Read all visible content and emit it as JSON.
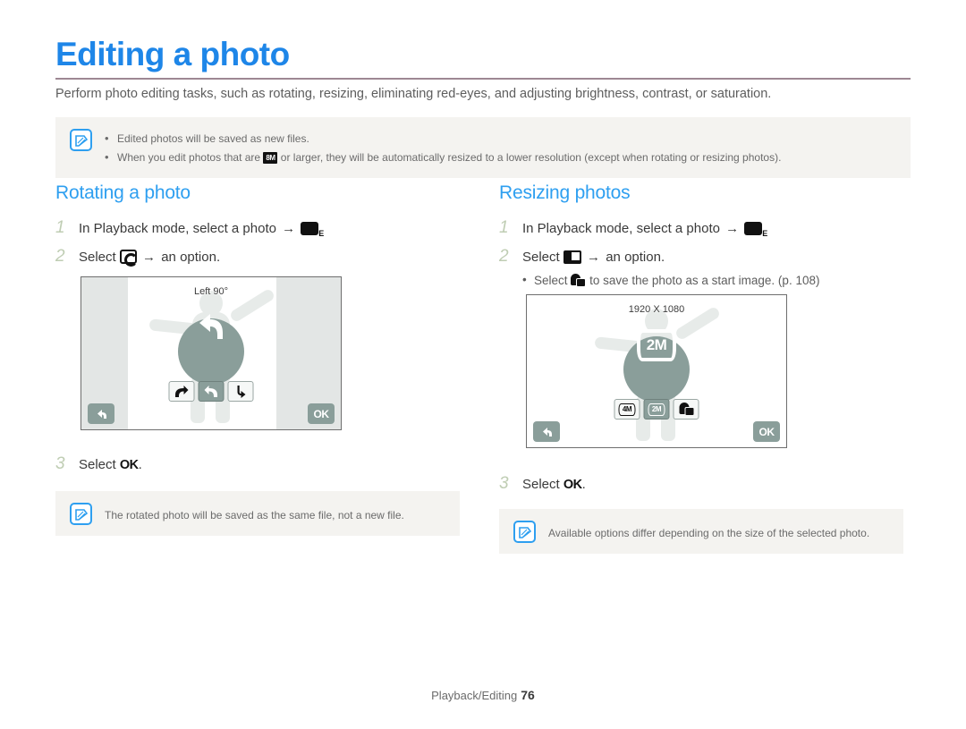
{
  "document": {
    "title": "Editing a photo",
    "intro": "Perform photo editing tasks, such as rotating, resizing, eliminating red-eyes, and adjusting brightness, contrast, or saturation.",
    "accent_color": "#1e86e8",
    "rule_color": "#9d8793"
  },
  "top_note": {
    "icon": "note-pen-icon",
    "bullets": [
      "Edited photos will be saved as new files.",
      "When you edit photos that are   or larger, they will be automatically resized to a lower resolution (except when rotating or resizing photos)."
    ],
    "bullet2_before": "When you edit photos that are",
    "bullet2_icon": "8M",
    "bullet2_after": "or larger, they will be automatically resized to a lower resolution (except when rotating or resizing photos)."
  },
  "rotating": {
    "heading": "Rotating a photo",
    "step1": {
      "number": "1",
      "before": "In Playback mode, select a photo",
      "arrow": "→",
      "icon": "edit-menu-icon",
      "after": "."
    },
    "step2": {
      "number": "2",
      "before": "Select",
      "icon": "rotate-icon",
      "arrow": "→",
      "after": "an option."
    },
    "step3": {
      "number": "3",
      "before": "Select",
      "ok": "OK",
      "after": "."
    },
    "note": "The rotated photo will be saved as the same file, not a new file.",
    "screen": {
      "badge_label": "Left 90°",
      "badge_icon": "rotate-left-arrow-icon",
      "options": [
        {
          "name": "rotate-right-90-button",
          "icon": "arrow-curve-right-icon",
          "selected": false
        },
        {
          "name": "rotate-left-90-button",
          "icon": "arrow-curve-left-icon",
          "selected": true
        },
        {
          "name": "rotate-180-button",
          "icon": "arrow-flip-icon",
          "selected": false
        }
      ],
      "back_button": "back-icon",
      "ok_button": "OK"
    }
  },
  "resizing": {
    "heading": "Resizing photos",
    "step1": {
      "number": "1",
      "before": "In Playback mode, select a photo",
      "arrow": "→",
      "icon": "edit-menu-icon",
      "after": "."
    },
    "step2": {
      "number": "2",
      "before": "Select",
      "icon": "resize-icon",
      "arrow": "→",
      "after": "an option."
    },
    "substep": {
      "before": "Select",
      "icon": "start-image-icon",
      "after": "to save the photo as a start image. (p. 108)"
    },
    "step3": {
      "number": "3",
      "before": "Select",
      "ok": "OK",
      "after": "."
    },
    "note": "Available options differ depending on the size of the selected photo.",
    "screen": {
      "badge_label": "1920 X 1080",
      "badge_value": "2M",
      "options": [
        {
          "name": "size-4m-button",
          "label": "4M",
          "selected": false
        },
        {
          "name": "size-2m-button",
          "label": "2M",
          "selected": true
        },
        {
          "name": "start-image-button",
          "label": "",
          "icon": "start-image-icon",
          "selected": false
        }
      ],
      "back_button": "back-icon",
      "ok_button": "OK"
    }
  },
  "footer": {
    "section": "Playback/Editing",
    "page_number": "76"
  }
}
